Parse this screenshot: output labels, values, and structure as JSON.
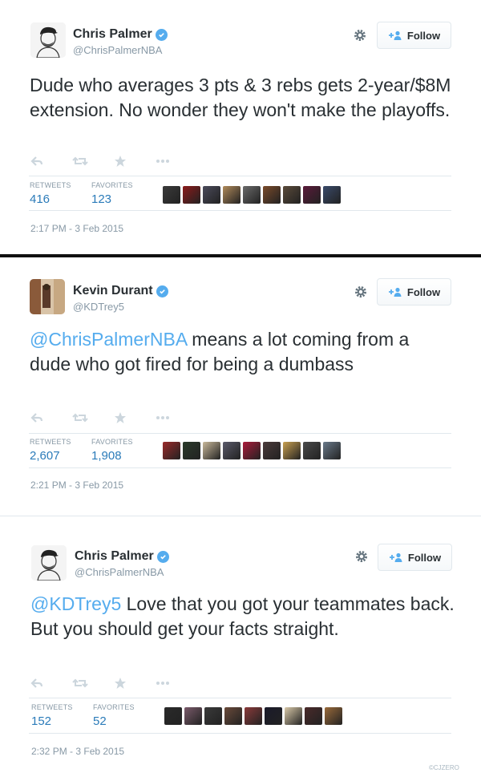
{
  "tweets": [
    {
      "name": "Chris Palmer",
      "handle": "@ChrisPalmerNBA",
      "follow_label": "Follow",
      "mention": "",
      "text": "Dude who averages 3 pts & 3 rebs gets 2-year/$8M extension. No wonder they won't make the playoffs.",
      "retweets_label": "RETWEETS",
      "retweets": "416",
      "favorites_label": "FAVORITES",
      "favorites": "123",
      "time": "2:17 PM - 3 Feb 2015",
      "avatar_icon": "cartoon-avatar-icon",
      "face_colors": [
        "#3a3a3a",
        "#8b1a1a",
        "#4a4a5a",
        "#b08a5a",
        "#6a6a6a",
        "#7a4a2a",
        "#5a4a3a",
        "#5a1a3a",
        "#3a4a6a"
      ]
    },
    {
      "name": "Kevin Durant",
      "handle": "@KDTrey5",
      "follow_label": "Follow",
      "mention": "@ChrisPalmerNBA",
      "text": " means a lot coming from a dude who got fired for being a dumbass",
      "retweets_label": "RETWEETS",
      "retweets": "2,607",
      "favorites_label": "FAVORITES",
      "favorites": "1,908",
      "time": "2:21 PM - 3 Feb 2015",
      "avatar_icon": "photo-avatar-icon",
      "face_colors": [
        "#9a2a2a",
        "#2a3a2a",
        "#c8b89a",
        "#5a5a6a",
        "#aa1a3a",
        "#4a3a3a",
        "#c8a050",
        "#4a4a4a",
        "#6a7a8a"
      ]
    },
    {
      "name": "Chris Palmer",
      "handle": "@ChrisPalmerNBA",
      "follow_label": "Follow",
      "mention": "@KDTrey5",
      "text": " Love that you got your teammates back. But you should get your facts straight.",
      "retweets_label": "RETWEETS",
      "retweets": "152",
      "favorites_label": "FAVORITES",
      "favorites": "52",
      "time": "2:32 PM - 3 Feb 2015",
      "avatar_icon": "cartoon-avatar-icon",
      "face_colors": [
        "#2a2a2a",
        "#7a5a6a",
        "#3a3a3a",
        "#6a4a3a",
        "#8a3a3a",
        "#1a1a2a",
        "#d8c8a8",
        "#4a2a2a",
        "#9a6a3a"
      ]
    }
  ],
  "watermark": "©CJZERO",
  "colors": {
    "link": "#55acee",
    "stat": "#2b7bb9",
    "muted": "#8899a6",
    "text": "#292f33"
  }
}
